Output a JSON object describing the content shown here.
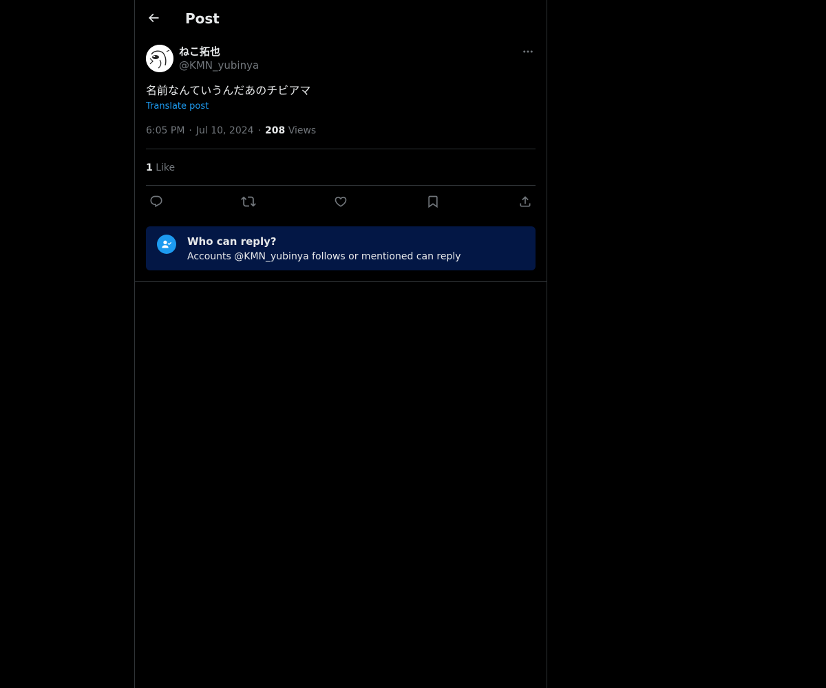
{
  "header": {
    "title": "Post",
    "back_icon": "arrow-left-icon"
  },
  "post": {
    "author": {
      "display_name": "ねこ拓也",
      "handle": "@KMN_yubinya"
    },
    "text": "名前なんていうんだあのチビアマ",
    "translate_label": "Translate post",
    "time": "6:05 PM",
    "date": "Jul 10, 2024",
    "separator": "·",
    "views_count": "208",
    "views_label": "Views",
    "likes_count": "1",
    "likes_label": "Like"
  },
  "actions": [
    {
      "name": "reply",
      "icon": "reply-icon"
    },
    {
      "name": "repost",
      "icon": "repost-icon"
    },
    {
      "name": "like",
      "icon": "heart-icon"
    },
    {
      "name": "bookmark",
      "icon": "bookmark-icon"
    },
    {
      "name": "share",
      "icon": "share-icon"
    }
  ],
  "reply_restriction": {
    "title": "Who can reply?",
    "description": "Accounts @KMN_yubinya follows or mentioned can reply",
    "icon": "user-check-icon"
  },
  "colors": {
    "background": "#000000",
    "text": "#e7e9ea",
    "muted": "#71767b",
    "accent": "#1d9bf0",
    "border": "#2f3336",
    "reply_box": "#031745"
  }
}
